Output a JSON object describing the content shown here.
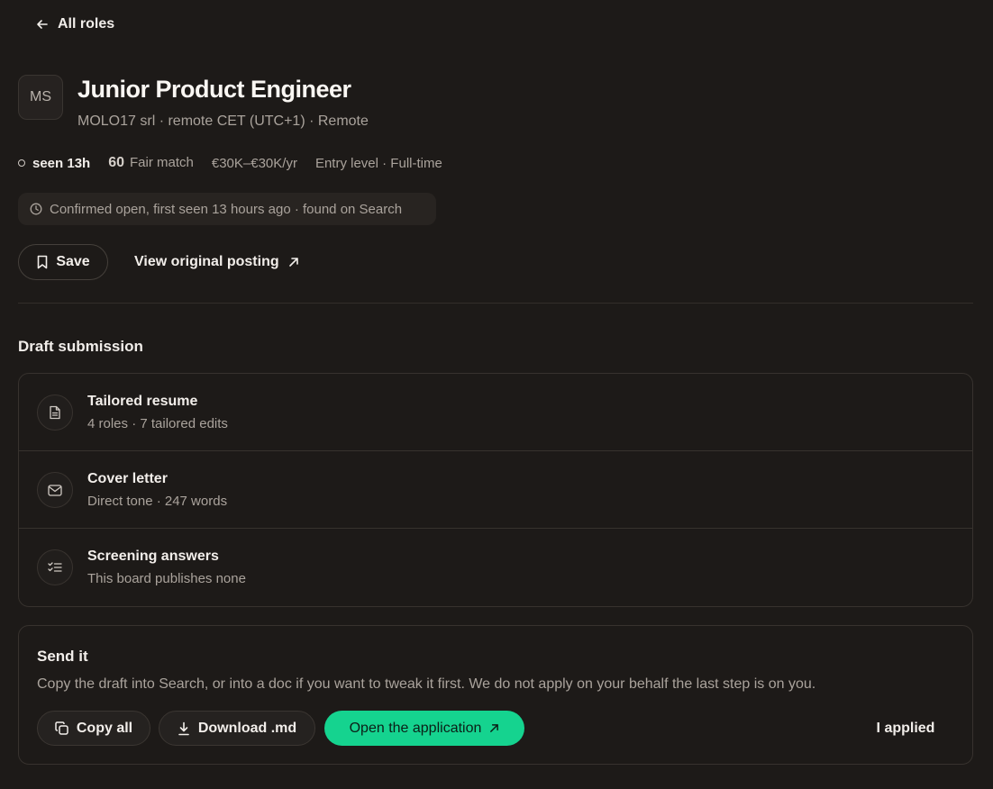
{
  "nav": {
    "back_label": "All roles"
  },
  "job": {
    "logo_initials": "MS",
    "title": "Junior Product Engineer",
    "subtitle": "MOLO17 srl · remote CET (UTC+1) · Remote",
    "seen": "seen 13h",
    "score": "60",
    "score_label": "Fair match",
    "salary": "€30K–€30K/yr",
    "level": "Entry level · Full-time",
    "status": "Confirmed open, first seen 13 hours ago · found on Search"
  },
  "actions": {
    "save_label": "Save",
    "view_label": "View original posting"
  },
  "draft": {
    "heading": "Draft submission",
    "items": [
      {
        "title": "Tailored resume",
        "sub": "4 roles · 7 tailored edits",
        "icon": "file-text-icon"
      },
      {
        "title": "Cover letter",
        "sub": "Direct tone · 247 words",
        "icon": "mail-icon"
      },
      {
        "title": "Screening answers",
        "sub": "This board publishes none",
        "icon": "checklist-icon"
      }
    ]
  },
  "send": {
    "heading": "Send it",
    "description": "Copy the draft into Search, or into a doc if you want to tweak it first. We do not apply on your behalf the last step is on you.",
    "copy_label": "Copy all",
    "download_label": "Download .md",
    "open_label": "Open the application",
    "applied_label": "I applied"
  },
  "colors": {
    "background": "#1d1a18",
    "accent": "#15d38f",
    "muted_text": "#aaa39c"
  }
}
